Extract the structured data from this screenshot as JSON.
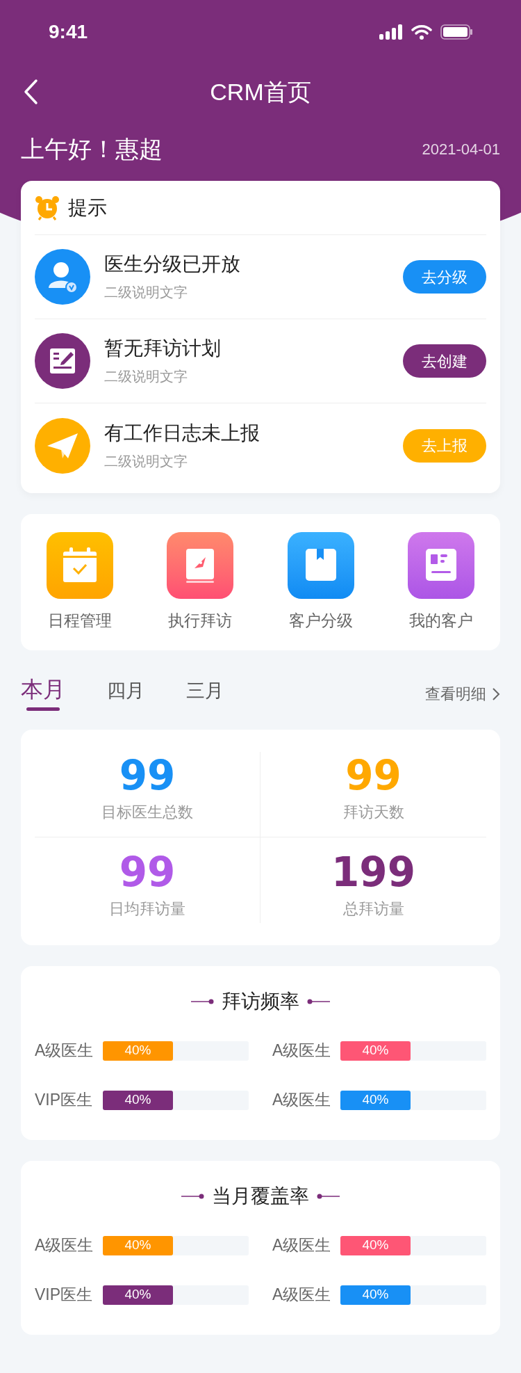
{
  "status_bar": {
    "time": "9:41"
  },
  "nav": {
    "title": "CRM首页"
  },
  "greeting": "上午好！惠超",
  "date": "2021-04-01",
  "tips": {
    "title": "提示",
    "items": [
      {
        "kind": "doctor",
        "title": "医生分级已开放",
        "subtitle": "二级说明文字",
        "action": "去分级",
        "color": "#1890f5"
      },
      {
        "kind": "plan",
        "title": "暂无拜访计划",
        "subtitle": "二级说明文字",
        "action": "去创建",
        "color": "#7b2d7a"
      },
      {
        "kind": "report",
        "title": "有工作日志未上报",
        "subtitle": "二级说明文字",
        "action": "去上报",
        "color": "#ffb000"
      }
    ]
  },
  "shortcuts": [
    {
      "kind": "calendar",
      "label": "日程管理"
    },
    {
      "kind": "visit",
      "label": "执行拜访"
    },
    {
      "kind": "grade",
      "label": "客户分级"
    },
    {
      "kind": "customers",
      "label": "我的客户"
    }
  ],
  "period_tabs": [
    {
      "label": "本月",
      "selected": true
    },
    {
      "label": "四月",
      "selected": false
    },
    {
      "label": "三月",
      "selected": false
    }
  ],
  "details_link": "查看明细",
  "stats": [
    {
      "value": "99",
      "label": "目标医生总数",
      "color": "#1890f5"
    },
    {
      "value": "99",
      "label": "拜访天数",
      "color": "#ffa800"
    },
    {
      "value": "99",
      "label": "日均拜访量",
      "color": "#b05ae8"
    },
    {
      "value": "199",
      "label": "总拜访量",
      "color": "#7b2d7a"
    }
  ],
  "rate_sections": [
    {
      "title": "拜访频率",
      "rows": [
        {
          "label": "A级医生",
          "reading": "40%",
          "level": 0.48,
          "color": "#ff9500"
        },
        {
          "label": "A级医生",
          "reading": "40%",
          "level": 0.48,
          "color": "#fe5675"
        },
        {
          "label": "VIP医生",
          "reading": "40%",
          "level": 0.48,
          "color": "#7b2d7a"
        },
        {
          "label": "A级医生",
          "reading": "40%",
          "level": 0.48,
          "color": "#1890f5"
        }
      ]
    },
    {
      "title": "当月覆盖率",
      "rows": [
        {
          "label": "A级医生",
          "reading": "40%",
          "level": 0.48,
          "color": "#ff9500"
        },
        {
          "label": "A级医生",
          "reading": "40%",
          "level": 0.48,
          "color": "#fe5675"
        },
        {
          "label": "VIP医生",
          "reading": "40%",
          "level": 0.48,
          "color": "#7b2d7a"
        },
        {
          "label": "A级医生",
          "reading": "40%",
          "level": 0.48,
          "color": "#1890f5"
        }
      ]
    }
  ]
}
